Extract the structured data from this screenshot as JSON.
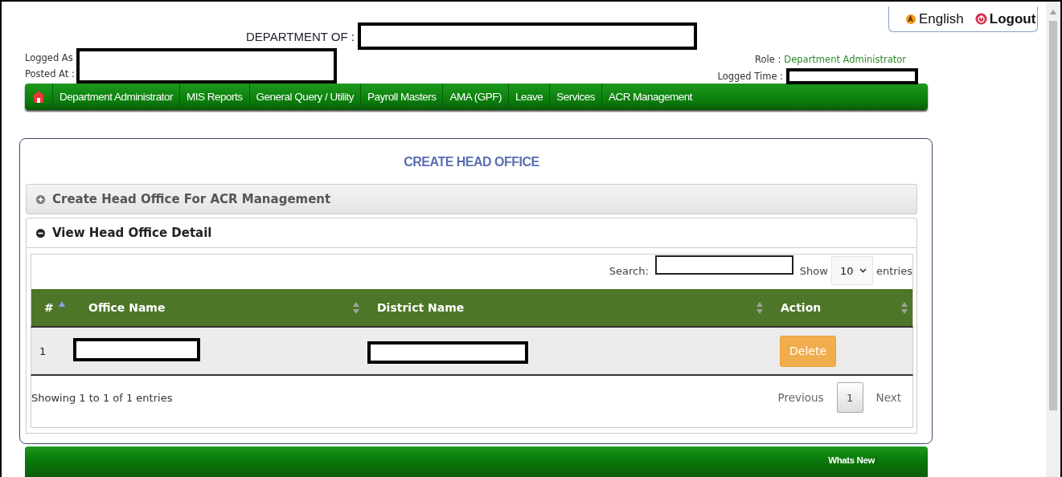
{
  "header": {
    "department_label": "DEPARTMENT OF :",
    "logged_as_label": "Logged As",
    "posted_at_label": "Posted At :",
    "role_label": "Role :",
    "role_value": "Department Administrator",
    "logged_time_label": "Logged Time :"
  },
  "top_links": [
    {
      "label": "English",
      "kind": "language"
    },
    {
      "label": "Logout",
      "kind": "logout"
    }
  ],
  "nav": {
    "items": [
      "Department Administrator",
      "MIS Reports",
      "General Query / Utility",
      "Payroll Masters",
      "AMA (GPF)",
      "Leave",
      "Services",
      "ACR Management"
    ]
  },
  "page_title": "CREATE HEAD OFFICE",
  "sections": [
    {
      "title": "Create Head Office For ACR Management",
      "expanded": false
    },
    {
      "title": "View Head Office Detail",
      "expanded": true
    }
  ],
  "table": {
    "search_label": "Search:",
    "show_label": "Show",
    "page_size": "10",
    "entries_label": "entries",
    "columns": [
      {
        "label": "#",
        "sorted": true
      },
      {
        "label": "Office Name",
        "sorted": false
      },
      {
        "label": "District Name",
        "sorted": false
      },
      {
        "label": "Action",
        "sorted": false
      }
    ],
    "rows": [
      {
        "index": "1",
        "action": "Delete"
      }
    ],
    "info": "Showing 1 to 1 of 1 entries",
    "pagination": {
      "previous": "Previous",
      "pages": [
        {
          "label": "1",
          "selected": true
        }
      ],
      "next": "Next"
    }
  },
  "footer": {
    "whats_new": "Whats New"
  }
}
